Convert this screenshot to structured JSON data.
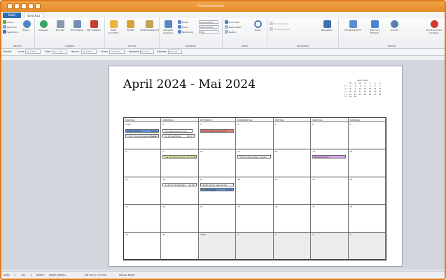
{
  "window": {
    "title": "Druckvorschau"
  },
  "tabs": {
    "file": "Datei",
    "active": "Vorschau"
  },
  "ribbon": {
    "groups": [
      {
        "label": "Bereich"
      },
      {
        "label": "Ausgabe"
      },
      {
        "label": "Format"
      },
      {
        "label": "Anpassen"
      },
      {
        "label": "Zoom"
      },
      {
        "label": "Navigation"
      },
      {
        "label": "Ansicht"
      }
    ],
    "buttons": {
      "listen": "Listen...",
      "optionen": "Optionen",
      "speichern": "Speichern...",
      "eigen": "Eigen...",
      "anzeigen": "Anzeigen",
      "drucken": "Drucken",
      "druckdialog": "Druckdialog",
      "pdf": "PDF erstellen",
      "seite_einrichten": "Seite einrichten",
      "format": "Format",
      "seitenhintergrund": "Seitenhintergrund",
      "auf_seite_anpassen": "Auf Seite anpassen",
      "breite": "Breite",
      "hoehe": "Höhe",
      "skalierung": "Skalierung",
      "eine_seite": "Eine Seite",
      "zwei_seiten": "Zwei Seiten",
      "seiten": "Seiten",
      "zoom": "Zoom",
      "naechste_seite": "Nächste Seite",
      "vorherige_seite": "Vorherige Seite",
      "navigation": "Navigation",
      "miniaturansicht": "Miniaturansicht",
      "kopf_fusszeile": "Kopf- und Fußzeile",
      "ansicht": "Ansicht",
      "schliessen": "Druckvorschau schließen"
    },
    "breite_value": "Automatisch",
    "hoehe_value": "Automatisch",
    "skalierung_value": "100"
  },
  "margins": {
    "raender_label": "Ränder",
    "links_label": "Links",
    "links_value": "12,7 mm",
    "oben_label": "Oben",
    "oben_value": "12,7 mm",
    "rechts_label": "Rechts",
    "rechts_value": "12,7 mm",
    "unten_label": "Unten",
    "unten_value": "12,7 mm",
    "kopfzeile_label": "Kopfzeile",
    "kopfzeile_value": "6,3 mm",
    "fusszeile_label": "Fußzeile",
    "fusszeile_value": "6,3 mm"
  },
  "page": {
    "title": "April 2024 - Mai 2024",
    "mini_calendar": {
      "title": "April 2024",
      "headers": [
        "",
        "M",
        "D",
        "M",
        "D",
        "F",
        "S",
        "S"
      ],
      "rows": [
        [
          "14",
          "1",
          "2",
          "3",
          "4",
          "5",
          "6",
          "7"
        ],
        [
          "15",
          "8",
          "9",
          "10",
          "11",
          "12",
          "13",
          "14"
        ],
        [
          "16",
          "15",
          "16",
          "17",
          "18",
          "19",
          "20",
          "21"
        ],
        [
          "17",
          "22",
          "23",
          "24",
          "25",
          "26",
          "27",
          "28"
        ],
        [
          "18",
          "29",
          "30",
          "",
          "",
          "",
          "",
          ""
        ]
      ]
    },
    "weekdays": [
      "MONTAG",
      "DIENSTAG",
      "MITTWOCH",
      "DONNERSTAG",
      "FREITAG",
      "SAMSTAG",
      "SONNTAG"
    ],
    "weeks": [
      [
        "1 Apr",
        "2",
        "3",
        "4",
        "5",
        "6",
        "7"
      ],
      [
        "8",
        "9",
        "10",
        "11",
        "12",
        "13",
        "14"
      ],
      [
        "15",
        "16",
        "17",
        "18",
        "19",
        "20",
        "21"
      ],
      [
        "22",
        "23",
        "24",
        "25",
        "26",
        "27",
        "28"
      ],
      [
        "29",
        "30",
        "1 Mai",
        "2",
        "3",
        "4",
        "5"
      ]
    ],
    "events": {
      "e1": "09:00 Meeting",
      "e1_time": "10:00",
      "e2": "13:00 Vorstandsbesprechung",
      "e2_time": "14:00",
      "e3": "Aufgabenbesprechung",
      "e4": "16:00 Nachfolge",
      "e4_time": "18:00",
      "e5": "14:15 Termin Spez 16:00",
      "e6": "Marketingkampagne und Briefing",
      "e7": "Mitarbeiterfeedback senden",
      "e8": "Budget planen",
      "e9": "11:00 IT Infrastruktur",
      "e9_time": "12:00",
      "e10": "09:00 Termin Spez 10:00",
      "e11": "11:00 Meeting",
      "e11_time": "12:00"
    },
    "colors": {
      "blue_event": "#5b8fd6",
      "red_event": "#e27c6e",
      "yellow_event": "#eef0a6",
      "pink_event": "#d9a3e6",
      "white_event": "#ffffff"
    }
  },
  "status": {
    "seite_label": "Seite:",
    "seite_value": "1",
    "von_label": "von",
    "von_value": "1",
    "seiten_label": "Seiten:",
    "papier_label": "Papier: Bildfor...",
    "papier_size": "216 mm × 279 mm",
    "status_label": "Status: Bereit"
  },
  "theme": {
    "accent": "#e48a25",
    "file_tab": "#2f6db3"
  }
}
